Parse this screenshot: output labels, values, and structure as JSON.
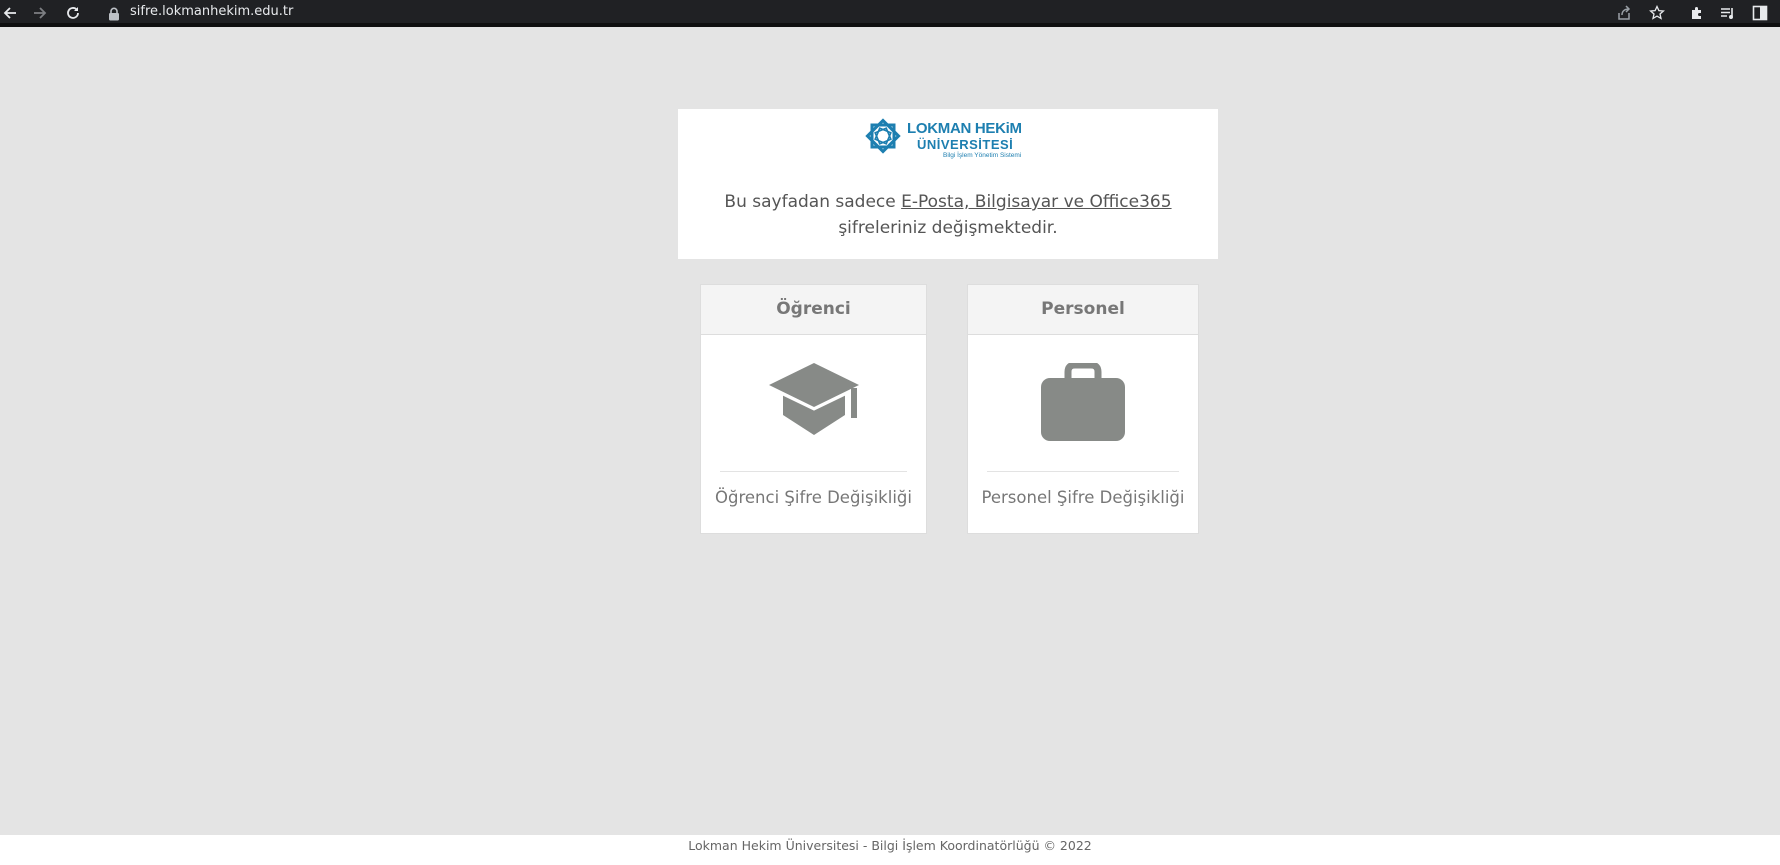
{
  "browser": {
    "url": "sifre.lokmanhekim.edu.tr",
    "icons": [
      "back-arrow-icon",
      "forward-arrow-icon",
      "reload-icon",
      "lock-icon",
      "share-icon",
      "star-icon",
      "extensions-icon",
      "media-control-icon",
      "side-panel-icon"
    ]
  },
  "logo": {
    "name": "LOKMAN HEKiM",
    "sub": "ÜNİVERSİTESİ",
    "tagline": "Bilgi İşlem Yönetim Sistemi",
    "color": "#1d7fb0"
  },
  "info": {
    "text_before": "Bu sayfadan sadece ",
    "link_text": "E-Posta, Bilgisayar ve Office365",
    "text_after": " şifreleriniz değişmektedir."
  },
  "cards": {
    "student": {
      "title": "Öğrenci",
      "icon": "graduation-cap-icon",
      "label": "Öğrenci Şifre Değişikliği"
    },
    "staff": {
      "title": "Personel",
      "icon": "briefcase-icon",
      "label": "Personel Şifre Değişikliği"
    }
  },
  "footer": {
    "text": "Lokman Hekim Üniversitesi - Bilgi İşlem Koordinatörlüğü © 2022"
  },
  "colors": {
    "page_bg": "#e4e4e4",
    "icon_gray": "#878a87",
    "text_gray": "#777777"
  }
}
